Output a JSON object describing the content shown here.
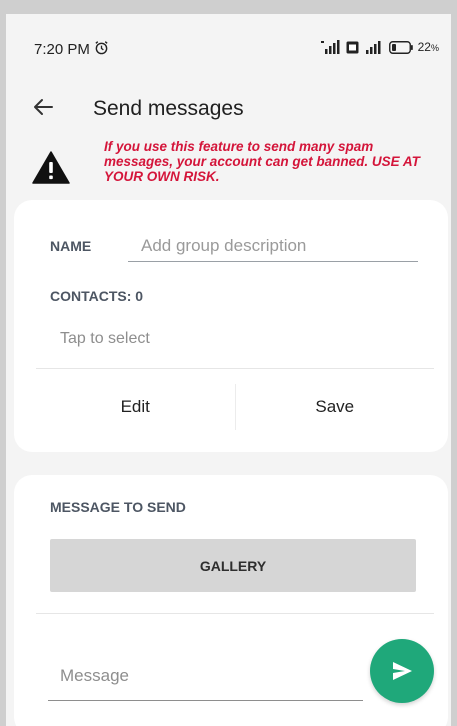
{
  "status_bar": {
    "time": "7:20 PM",
    "battery": "22",
    "battery_unit": "%"
  },
  "app_bar": {
    "title": "Send messages",
    "back_icon": "back-arrow-icon"
  },
  "warning": {
    "icon": "warning-icon",
    "text": "If you use this feature to send many spam messages, your account can get banned. USE AT YOUR OWN RISK."
  },
  "group_card": {
    "name_label": "NAME",
    "name_value": "",
    "name_placeholder": "Add group description",
    "contacts_label": "CONTACTS: 0",
    "select_text": "Tap to select",
    "edit_label": "Edit",
    "save_label": "Save"
  },
  "message_card": {
    "label": "MESSAGE TO SEND",
    "gallery_label": "GALLERY",
    "message_value": "",
    "message_placeholder": "Message",
    "send_icon": "send-icon"
  },
  "colors": {
    "warning_red": "#d4153a",
    "send_green": "#1fa87a",
    "background": "#f4f4f4"
  }
}
